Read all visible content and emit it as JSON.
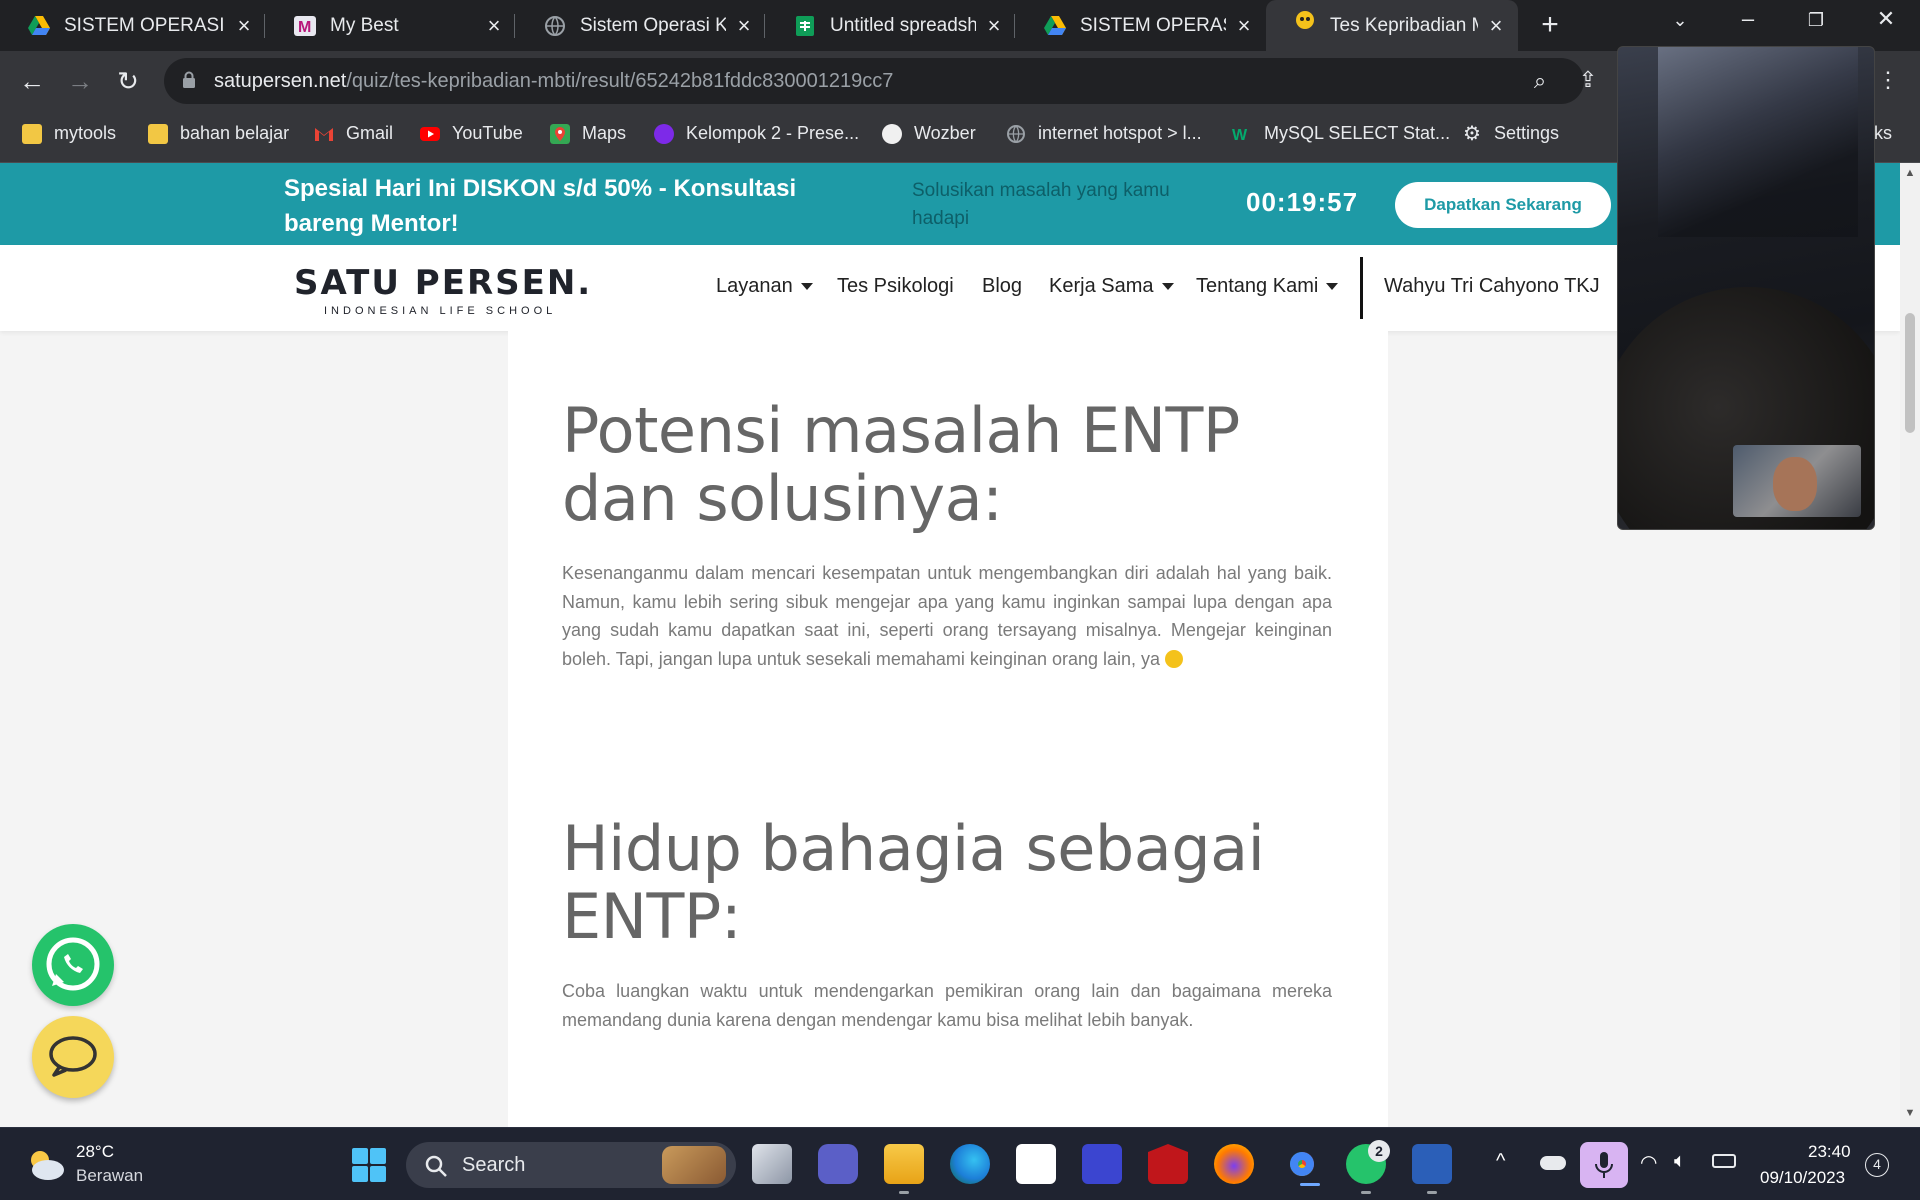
{
  "tabs": [
    {
      "title": "SISTEM OPERASI II",
      "icon": "google-drive-icon"
    },
    {
      "title": "My Best",
      "icon": "mybest-icon"
    },
    {
      "title": "Sistem Operasi Kor",
      "icon": "globe-icon"
    },
    {
      "title": "Untitled spreadshe",
      "icon": "google-sheets-icon"
    },
    {
      "title": "SISTEM OPERASI II",
      "icon": "google-drive-icon"
    },
    {
      "title": "Tes Kepribadian MI",
      "icon": "satupersen-icon",
      "active": true
    }
  ],
  "address_bar": {
    "host": "satupersen.net",
    "path": "/quiz/tes-kepribadian-mbti/result/65242b81fddc830001219cc7"
  },
  "bookmarks": [
    {
      "label": "mytools",
      "icon": "folder-icon"
    },
    {
      "label": "bahan belajar",
      "icon": "folder-icon"
    },
    {
      "label": "Gmail",
      "icon": "gmail-icon"
    },
    {
      "label": "YouTube",
      "icon": "youtube-icon"
    },
    {
      "label": "Maps",
      "icon": "maps-icon"
    },
    {
      "label": "Kelompok 2 - Prese...",
      "icon": "canva-icon"
    },
    {
      "label": "Wozber",
      "icon": "wozber-icon"
    },
    {
      "label": "internet hotspot > l...",
      "icon": "globe-icon"
    },
    {
      "label": "MySQL SELECT Stat...",
      "icon": "w3schools-icon"
    },
    {
      "label": "Settings",
      "icon": "gear-icon"
    },
    {
      "label": "rks",
      "icon": ""
    }
  ],
  "promo": {
    "title": "Spesial Hari Ini DISKON s/d 50% - Konsultasi bareng Mentor!",
    "subtitle": "Solusikan masalah yang kamu hadapi",
    "timer": "00:19:57",
    "cta": "Dapatkan Sekarang"
  },
  "site": {
    "logo_main": "SATU PERSEN.",
    "logo_sub": "INDONESIAN LIFE SCHOOL",
    "nav": {
      "layanan": "Layanan",
      "tes": "Tes Psikologi",
      "blog": "Blog",
      "kerjasama": "Kerja Sama",
      "tentang": "Tentang Kami",
      "user": "Wahyu Tri Cahyono TKJ"
    }
  },
  "content": {
    "section1_title": "Potensi masalah ENTP dan solusinya:",
    "section1_body": "Kesenanganmu dalam mencari kesempatan untuk mengembangkan diri adalah hal yang baik. Namun, kamu lebih sering sibuk mengejar apa yang kamu inginkan sampai lupa dengan apa yang sudah kamu dapatkan saat ini, seperti orang tersayang misalnya. Mengejar keinginan boleh. Tapi, jangan lupa untuk sesekali memahami keinginan orang lain, ya",
    "section2_title": "Hidup bahagia sebagai ENTP:",
    "section2_body": "Coba luangkan waktu untuk mendengarkan pemikiran orang lain dan bagaimana mereka memandang dunia karena dengan mendengar kamu bisa melihat lebih banyak."
  },
  "taskbar": {
    "temp": "28°C",
    "weather": "Berawan",
    "search": "Search",
    "whatsapp_badge": "2",
    "time": "23:40",
    "date": "09/10/2023",
    "notifications": "4"
  },
  "colors": {
    "promo_bg": "#1e9aa6",
    "chrome_dark": "#202124",
    "chrome_toolbar": "#35363a",
    "taskbar": "#1f2330",
    "whatsapp": "#25c36b",
    "chat": "#f5d75a"
  }
}
